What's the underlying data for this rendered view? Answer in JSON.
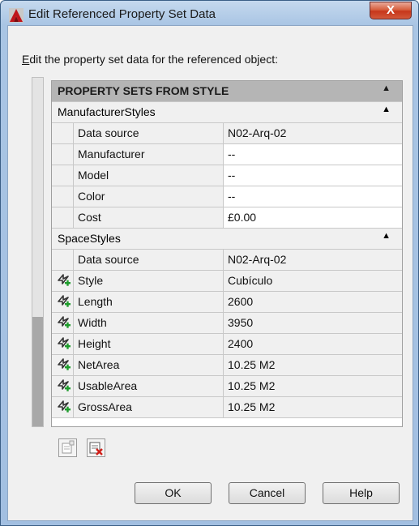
{
  "window": {
    "title": "Edit Referenced Property Set Data",
    "close_label": "X",
    "accent": "#c7361b"
  },
  "instruction": {
    "prefix": "E",
    "rest": "dit the property set data for the referenced object:"
  },
  "grid": {
    "header": "PROPERTY SETS FROM STYLE",
    "group1": {
      "name": "ManufacturerStyles",
      "rows": [
        {
          "name": "Data source",
          "value": "N02-Arq-02"
        },
        {
          "name": "Manufacturer",
          "value": "--"
        },
        {
          "name": "Model",
          "value": "--"
        },
        {
          "name": "Color",
          "value": "--"
        },
        {
          "name": "Cost",
          "value": "£0.00"
        }
      ]
    },
    "group2": {
      "name": "SpaceStyles",
      "rows": [
        {
          "name": "Data source",
          "value": "N02-Arq-02",
          "icon": ""
        },
        {
          "name": "Style",
          "value": "Cubículo",
          "icon": "formula-icon"
        },
        {
          "name": "Length",
          "value": "2600",
          "icon": "formula-icon"
        },
        {
          "name": "Width",
          "value": "3950",
          "icon": "formula-icon"
        },
        {
          "name": "Height",
          "value": "2400",
          "icon": "formula-icon"
        },
        {
          "name": "NetArea",
          "value": "10.25 M2",
          "icon": "formula-icon"
        },
        {
          "name": "UsableArea",
          "value": "10.25 M2",
          "icon": "formula-icon"
        },
        {
          "name": "GrossArea",
          "value": "10.25 M2",
          "icon": "formula-icon"
        }
      ]
    }
  },
  "toolbar": {
    "add_icon": "add-property-set-icon",
    "remove_icon": "remove-property-set-icon"
  },
  "buttons": {
    "ok": "OK",
    "cancel": "Cancel",
    "help": "Help"
  }
}
